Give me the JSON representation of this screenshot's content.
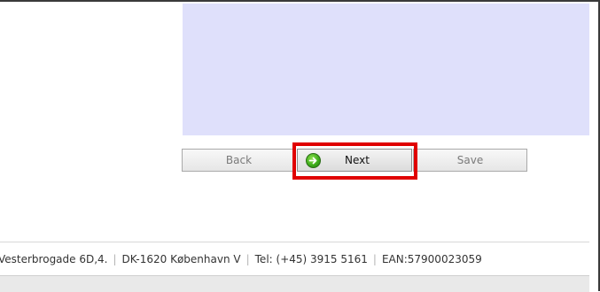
{
  "buttons": {
    "back_label": "Back",
    "next_label": "Next",
    "save_label": "Save"
  },
  "footer": {
    "address": "Vesterbrogade 6D,4.",
    "city": "DK-1620 København V",
    "phone": "Tel: (+45) 3915 5161",
    "ean": "EAN:57900023059"
  },
  "icons": {
    "next": "arrow-right-circle-icon"
  },
  "colors": {
    "content_panel": "#dfe0fb",
    "highlight": "#e00000",
    "next_icon": "#3aa81a"
  }
}
